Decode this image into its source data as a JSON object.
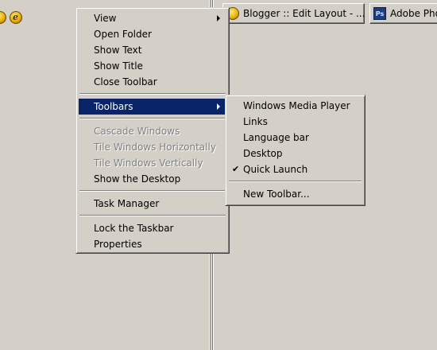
{
  "taskbar": {
    "buttons": [
      {
        "label": "Blogger :: Edit Layout - ...",
        "icon": "blogger-icon"
      },
      {
        "label": "Adobe Pho",
        "icon": "photoshop-icon",
        "icon_text": "Ps"
      }
    ],
    "tray_icons": [
      "quick-launch-icon",
      "quick-launch-icon"
    ]
  },
  "context_menu": {
    "items": [
      {
        "label": "View",
        "submenu": true
      },
      {
        "label": "Open Folder"
      },
      {
        "label": "Show Text"
      },
      {
        "label": "Show Title"
      },
      {
        "label": "Close Toolbar"
      },
      {
        "label": "Toolbars",
        "submenu": true,
        "highlighted": true
      },
      {
        "label": "Cascade Windows",
        "disabled": true
      },
      {
        "label": "Tile Windows Horizontally",
        "disabled": true
      },
      {
        "label": "Tile Windows Vertically",
        "disabled": true
      },
      {
        "label": "Show the Desktop"
      },
      {
        "label": "Task Manager"
      },
      {
        "label": "Lock the Taskbar"
      },
      {
        "label": "Properties"
      }
    ]
  },
  "toolbars_submenu": {
    "items": [
      {
        "label": "Windows Media Player",
        "checked": false
      },
      {
        "label": "Links",
        "checked": false
      },
      {
        "label": "Language bar",
        "checked": false
      },
      {
        "label": "Desktop",
        "checked": false
      },
      {
        "label": "Quick Launch",
        "checked": true,
        "check_glyph": "✔"
      },
      {
        "label": "New Toolbar..."
      }
    ]
  },
  "colors": {
    "face": "#d4d0c8",
    "highlight": "#0a246a",
    "disabled_text": "#808080"
  }
}
